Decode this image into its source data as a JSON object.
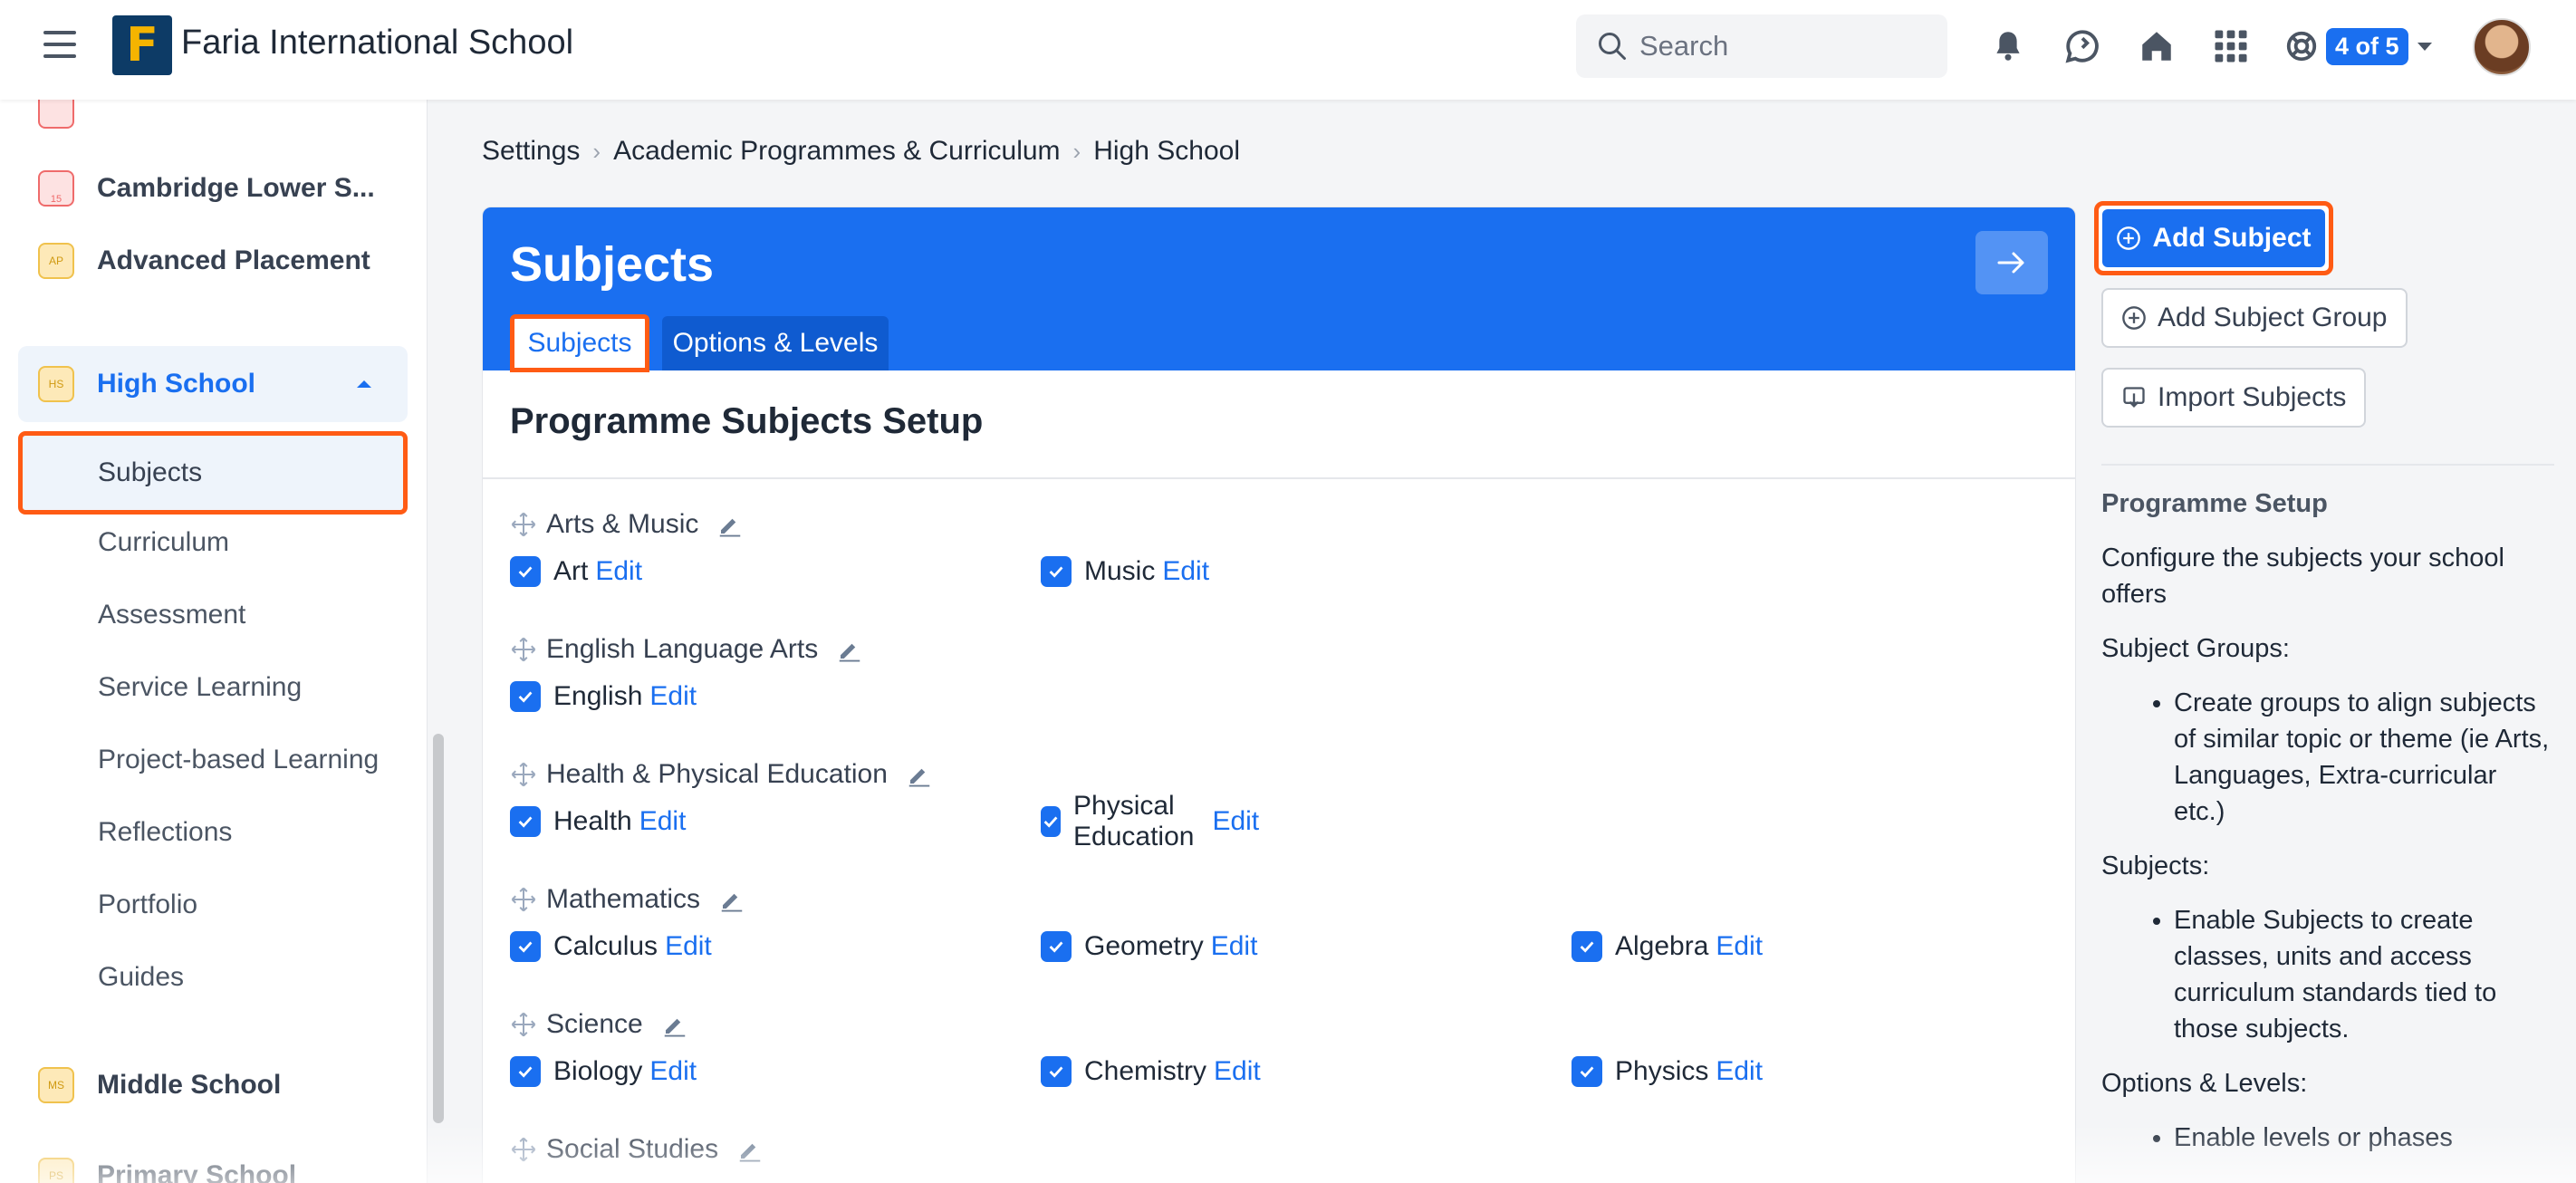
{
  "header": {
    "school_name": "Faria International School",
    "search_placeholder": "Search",
    "count_badge": "4 of 5",
    "icons": [
      "menu-icon",
      "bell-icon",
      "chat-icon",
      "home-icon",
      "apps-grid-icon",
      "lifebuoy-icon"
    ]
  },
  "colors": {
    "accent": "#1a6ff0",
    "highlight": "#ff5b14"
  },
  "sidebar": {
    "programmes": [
      {
        "label": "Cambridge Lower S...",
        "icon": "calendar-icon"
      },
      {
        "label": "Advanced Placement",
        "icon": "ap-icon"
      },
      {
        "label": "High School",
        "icon": "hs-icon",
        "active": true
      },
      {
        "label": "Middle School",
        "icon": "ms-icon"
      },
      {
        "label": "Primary School",
        "icon": "ps-icon"
      }
    ],
    "sub_items": [
      "Subjects",
      "Curriculum",
      "Assessment",
      "Service Learning",
      "Project-based Learning",
      "Reflections",
      "Portfolio",
      "Guides"
    ]
  },
  "breadcrumb": [
    "Settings",
    "Academic Programmes & Curriculum",
    "High School"
  ],
  "card": {
    "title": "Subjects",
    "tabs": [
      "Subjects",
      "Options & Levels"
    ],
    "section_title": "Programme Subjects Setup",
    "edit_label": "Edit",
    "groups": [
      {
        "name": "Arts & Music",
        "subjects": [
          "Art",
          "Music"
        ]
      },
      {
        "name": "English Language Arts",
        "subjects": [
          "English"
        ]
      },
      {
        "name": "Health & Physical Education",
        "subjects": [
          "Health",
          "Physical Education"
        ]
      },
      {
        "name": "Mathematics",
        "subjects": [
          "Calculus",
          "Geometry",
          "Algebra"
        ]
      },
      {
        "name": "Science",
        "subjects": [
          "Biology",
          "Chemistry",
          "Physics"
        ]
      },
      {
        "name": "Social Studies",
        "subjects": []
      }
    ]
  },
  "right_panel": {
    "add_subject": "Add Subject",
    "add_subject_group": "Add Subject Group",
    "import_subjects": "Import Subjects",
    "heading": "Programme Setup",
    "intro": "Configure the subjects your school offers",
    "subject_groups_label": "Subject Groups:",
    "subject_groups_bullet": "Create groups to align subjects of similar topic or theme (ie Arts, Languages, Extra-curricular etc.)",
    "subjects_label": "Subjects:",
    "subjects_bullet": "Enable Subjects to create classes, units and access curriculum standards tied to those subjects.",
    "options_label": "Options & Levels:",
    "options_bullet": "Enable levels or phases"
  }
}
